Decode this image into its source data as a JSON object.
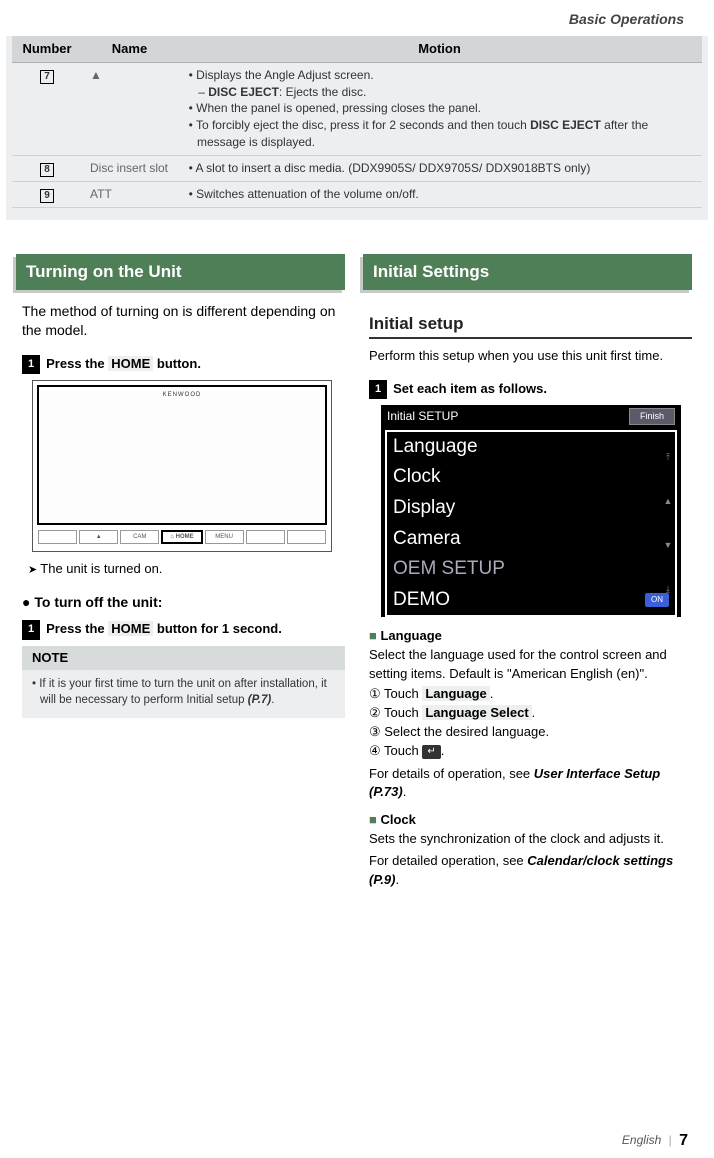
{
  "header": "Basic Operations",
  "table": {
    "headers": {
      "number": "Number",
      "name": "Name",
      "motion": "Motion"
    },
    "rows": [
      {
        "num": "7",
        "name": "▲",
        "lines": [
          "Displays the Angle Adjust screen.",
          ": Ejects the disc.",
          "When the panel is opened, pressing closes the panel.",
          "To forcibly eject the disc, press it for 2 seconds and then touch ",
          " after the message is displayed."
        ],
        "bold1": "DISC EJECT",
        "bold2": "DISC EJECT"
      },
      {
        "num": "8",
        "name": "Disc insert slot",
        "lines": [
          "A slot to insert a disc media. (DDX9905S/ DDX9705S/ DDX9018BTS only)"
        ]
      },
      {
        "num": "9",
        "name": "ATT",
        "lines": [
          "Switches attenuation of the volume on/off."
        ]
      }
    ]
  },
  "left": {
    "section": "Turning on the Unit",
    "intro": "The method of turning on is different depending on the model.",
    "step1": "Press the ",
    "home": "HOME",
    "step1b": " button.",
    "brand": "KENWOOD",
    "btns": [
      "",
      "▲",
      "CAM",
      "⌂ HOME",
      "MENU",
      "",
      ""
    ],
    "result": "The unit is turned on.",
    "turnoff": "To turn off the unit:",
    "step2": "Press the ",
    "step2b": " button for 1 second.",
    "note_head": "NOTE",
    "note_body": "If it is your first time to turn the unit on after installation, it will be necessary to perform Initial setup ",
    "note_ref": "(P.7)"
  },
  "right": {
    "section": "Initial Settings",
    "subtitle": "Initial setup",
    "intro": "Perform this setup when you use this unit first time.",
    "step1": "Set each item as follows.",
    "setup_title": "Initial SETUP",
    "finish": "Finish",
    "items": [
      "Language",
      "Clock",
      "Display",
      "Camera",
      "OEM SETUP",
      "DEMO"
    ],
    "on": "ON",
    "lang_head": "Language",
    "lang_body": "Select the language used for the control screen and setting items. Default is \"American English (en)\".",
    "c1": "① Touch ",
    "c1b": "Language",
    "c2": "② Touch ",
    "c2b": "Language Select",
    "c3": "③ Select the desired language.",
    "c4": "④ Touch ",
    "details": "For details of operation, see ",
    "details_ref": "User Interface Setup (P.73)",
    "clock_head": "Clock",
    "clock_body": "Sets the synchronization of the clock and adjusts it.",
    "clock_det": "For detailed operation, see ",
    "clock_ref": "Calendar/clock settings (P.9)"
  },
  "footer": {
    "lang": "English",
    "page": "7"
  }
}
